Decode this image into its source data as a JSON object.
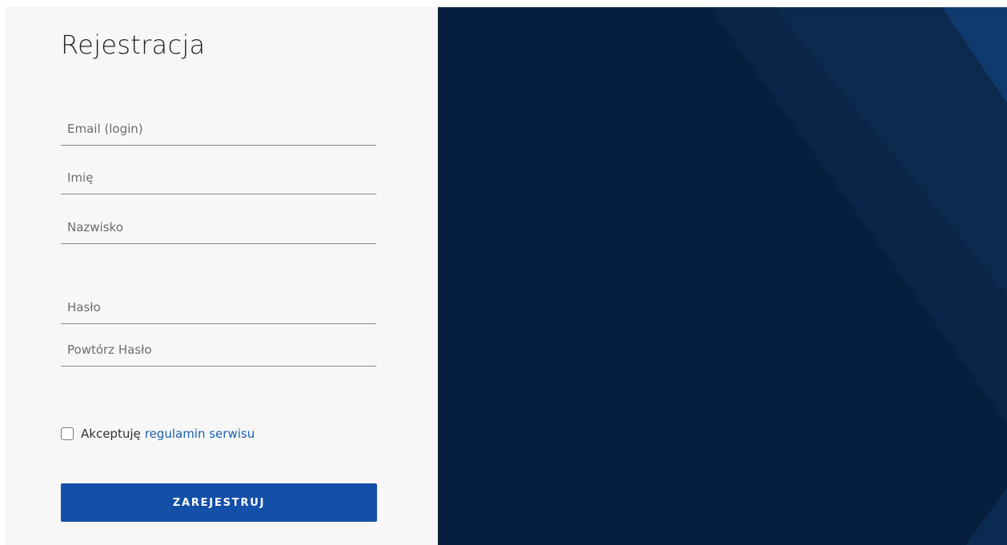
{
  "form": {
    "title": "Rejestracja",
    "fields": {
      "email_placeholder": "Email (login)",
      "first_name_placeholder": "Imię",
      "last_name_placeholder": "Nazwisko",
      "password_placeholder": "Hasło",
      "password_repeat_placeholder": "Powtórz Hasło"
    },
    "accept": {
      "checked": false,
      "text": "Akceptuję",
      "link_text": "regulamin serwisu"
    },
    "submit_label": "ZAREJESTRUJ"
  },
  "colors": {
    "form_background": "#f7f7f7",
    "hero_background": "#07203f",
    "accent_button": "#1450a8",
    "link": "#1b62b3"
  }
}
